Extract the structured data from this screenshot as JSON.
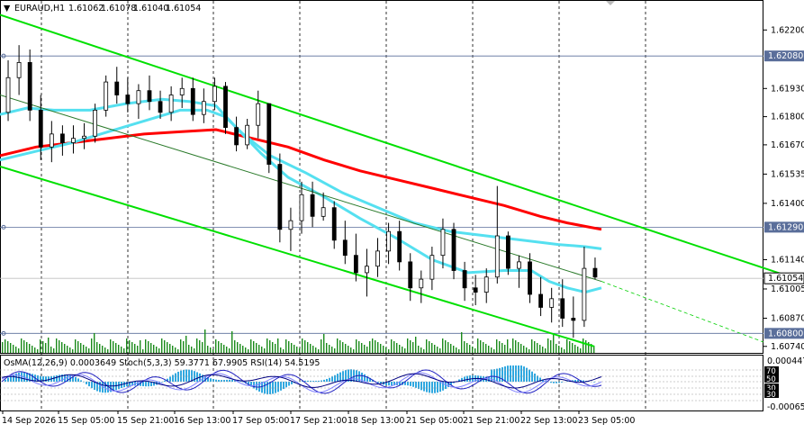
{
  "header": {
    "symbol": "EURAUD,H1",
    "open": "1.61062",
    "high": "1.61078",
    "low": "1.61040",
    "close": "1.61054"
  },
  "price_axis": {
    "labels": [
      {
        "text": "1.62200",
        "value": 1.622
      },
      {
        "text": "1.61930",
        "value": 1.6193
      },
      {
        "text": "1.61800",
        "value": 1.618
      },
      {
        "text": "1.61670",
        "value": 1.6167
      },
      {
        "text": "1.61535",
        "value": 1.61535
      },
      {
        "text": "1.61400",
        "value": 1.614
      },
      {
        "text": "1.61140",
        "value": 1.6114
      },
      {
        "text": "1.61005",
        "value": 1.61005
      },
      {
        "text": "1.60870",
        "value": 1.6087
      },
      {
        "text": "1.60740",
        "value": 1.6074
      }
    ],
    "level_tags": [
      {
        "text": "1.62080",
        "value": 1.6208
      },
      {
        "text": "1.61290",
        "value": 1.6129
      },
      {
        "text": "1.60800",
        "value": 1.608
      }
    ],
    "current_tag": {
      "text": "1.61054",
      "value": 1.61054
    }
  },
  "time_axis": [
    "14 Sep 2026",
    "15 Sep 05:00",
    "15 Sep 21:00",
    "16 Sep 13:00",
    "17 Sep 05:00",
    "17 Sep 21:00",
    "18 Sep 13:00",
    "21 Sep 05:00",
    "21 Sep 21:00",
    "22 Sep 13:00",
    "23 Sep 05:00"
  ],
  "indicator": {
    "title": "OsMA(12,26,9) 0.0003649  Stoch(5,3,3) 59.3771 67.9905  RSI(14) 54.5195",
    "top_label": "0.000447",
    "bottom_label": "-0.000655",
    "levels": [
      "70",
      "50",
      "30"
    ]
  },
  "chart_data": {
    "type": "candlestick",
    "y_range": [
      1.6071,
      1.6233
    ],
    "support_resistance_levels": [
      1.6208,
      1.6129,
      1.608
    ],
    "moving_averages": [
      {
        "color": "#ff0000",
        "points": [
          [
            0,
            1.6162
          ],
          [
            40,
            1.6166
          ],
          [
            80,
            1.6168
          ],
          [
            120,
            1.617
          ],
          [
            160,
            1.6172
          ],
          [
            200,
            1.6173
          ],
          [
            240,
            1.6174
          ],
          [
            280,
            1.617
          ],
          [
            320,
            1.6166
          ],
          [
            360,
            1.616
          ],
          [
            400,
            1.6155
          ],
          [
            440,
            1.6151
          ],
          [
            480,
            1.6147
          ],
          [
            520,
            1.6143
          ],
          [
            560,
            1.6139
          ],
          [
            600,
            1.6134
          ],
          [
            630,
            1.6131
          ],
          [
            655,
            1.6129
          ],
          [
            668,
            1.6128
          ]
        ]
      },
      {
        "color": "#55e0f0",
        "points": [
          [
            0,
            1.616
          ],
          [
            40,
            1.6164
          ],
          [
            80,
            1.6168
          ],
          [
            120,
            1.6173
          ],
          [
            160,
            1.6178
          ],
          [
            200,
            1.6183
          ],
          [
            230,
            1.6183
          ],
          [
            250,
            1.618
          ],
          [
            270,
            1.6172
          ],
          [
            300,
            1.6162
          ],
          [
            340,
            1.6154
          ],
          [
            380,
            1.6145
          ],
          [
            420,
            1.6138
          ],
          [
            460,
            1.6131
          ],
          [
            500,
            1.6127
          ],
          [
            540,
            1.6125
          ],
          [
            580,
            1.6123
          ],
          [
            620,
            1.6121
          ],
          [
            650,
            1.612
          ],
          [
            668,
            1.6119
          ]
        ]
      },
      {
        "color": "#55e0f0",
        "points": [
          [
            0,
            1.6181
          ],
          [
            30,
            1.6184
          ],
          [
            60,
            1.6183
          ],
          [
            100,
            1.6183
          ],
          [
            140,
            1.6186
          ],
          [
            180,
            1.6188
          ],
          [
            210,
            1.6187
          ],
          [
            240,
            1.6185
          ],
          [
            260,
            1.6176
          ],
          [
            290,
            1.6163
          ],
          [
            320,
            1.6152
          ],
          [
            360,
            1.6143
          ],
          [
            400,
            1.6133
          ],
          [
            440,
            1.6124
          ],
          [
            480,
            1.6114
          ],
          [
            520,
            1.6108
          ],
          [
            560,
            1.6109
          ],
          [
            590,
            1.6109
          ],
          [
            610,
            1.6104
          ],
          [
            630,
            1.6101
          ],
          [
            650,
            1.6099
          ],
          [
            668,
            1.6101
          ]
        ]
      }
    ],
    "channel_lines": [
      {
        "color": "#00e000",
        "from": [
          0,
          1.6227
        ],
        "to": [
          893,
          1.6104
        ]
      },
      {
        "color": "#00e000",
        "from": [
          0,
          1.6157
        ],
        "to": [
          660,
          1.6074
        ]
      },
      {
        "color": "#2a7a2a",
        "from": [
          0,
          1.619
        ],
        "to": [
          668,
          1.6104
        ]
      }
    ],
    "candles": [
      [
        1.6182,
        1.6206,
        1.6178,
        1.6198
      ],
      [
        1.6198,
        1.6213,
        1.619,
        1.6205
      ],
      [
        1.6205,
        1.6211,
        1.6178,
        1.6183
      ],
      [
        1.6183,
        1.619,
        1.616,
        1.6166
      ],
      [
        1.6166,
        1.6178,
        1.6159,
        1.6172
      ],
      [
        1.6172,
        1.6176,
        1.6162,
        1.6168
      ],
      [
        1.6168,
        1.6176,
        1.6163,
        1.617
      ],
      [
        1.617,
        1.6177,
        1.6165,
        1.6171
      ],
      [
        1.6171,
        1.6186,
        1.6168,
        1.6183
      ],
      [
        1.6183,
        1.6199,
        1.618,
        1.6196
      ],
      [
        1.6196,
        1.6203,
        1.6186,
        1.619
      ],
      [
        1.619,
        1.6198,
        1.6182,
        1.6186
      ],
      [
        1.6186,
        1.6195,
        1.6179,
        1.6192
      ],
      [
        1.6192,
        1.6199,
        1.6183,
        1.6187
      ],
      [
        1.6187,
        1.6192,
        1.6179,
        1.6182
      ],
      [
        1.6182,
        1.6194,
        1.6178,
        1.619
      ],
      [
        1.619,
        1.6198,
        1.6184,
        1.6193
      ],
      [
        1.6193,
        1.6198,
        1.6178,
        1.6181
      ],
      [
        1.6181,
        1.6193,
        1.6177,
        1.6187
      ],
      [
        1.6187,
        1.6198,
        1.6183,
        1.6194
      ],
      [
        1.6194,
        1.6196,
        1.6172,
        1.6175
      ],
      [
        1.6175,
        1.618,
        1.6164,
        1.6167
      ],
      [
        1.6167,
        1.6179,
        1.6165,
        1.6176
      ],
      [
        1.6176,
        1.6192,
        1.617,
        1.6186
      ],
      [
        1.6186,
        1.6186,
        1.6154,
        1.6158
      ],
      [
        1.6158,
        1.6163,
        1.6122,
        1.6128
      ],
      [
        1.6128,
        1.6138,
        1.6118,
        1.6132
      ],
      [
        1.6132,
        1.615,
        1.6126,
        1.6144
      ],
      [
        1.6144,
        1.615,
        1.6129,
        1.6134
      ],
      [
        1.6134,
        1.6145,
        1.6132,
        1.6138
      ],
      [
        1.6138,
        1.6141,
        1.6119,
        1.6123
      ],
      [
        1.6123,
        1.6132,
        1.6112,
        1.6116
      ],
      [
        1.6116,
        1.6126,
        1.6104,
        1.6108
      ],
      [
        1.6108,
        1.6119,
        1.6097,
        1.6111
      ],
      [
        1.6111,
        1.6124,
        1.6106,
        1.6118
      ],
      [
        1.6118,
        1.6131,
        1.6112,
        1.6127
      ],
      [
        1.6127,
        1.6132,
        1.6109,
        1.6113
      ],
      [
        1.6113,
        1.6117,
        1.6095,
        1.6101
      ],
      [
        1.6101,
        1.6109,
        1.6094,
        1.6105
      ],
      [
        1.6105,
        1.612,
        1.61,
        1.6116
      ],
      [
        1.6116,
        1.6133,
        1.611,
        1.6128
      ],
      [
        1.6128,
        1.6131,
        1.6105,
        1.6109
      ],
      [
        1.6109,
        1.6113,
        1.6095,
        1.6101
      ],
      [
        1.6101,
        1.6107,
        1.6093,
        1.6099
      ],
      [
        1.6099,
        1.611,
        1.6094,
        1.6106
      ],
      [
        1.6106,
        1.6148,
        1.6103,
        1.6125
      ],
      [
        1.6125,
        1.6127,
        1.6107,
        1.611
      ],
      [
        1.611,
        1.6116,
        1.6101,
        1.6113
      ],
      [
        1.6113,
        1.6117,
        1.6094,
        1.6098
      ],
      [
        1.6098,
        1.6106,
        1.6088,
        1.6092
      ],
      [
        1.6092,
        1.6101,
        1.6085,
        1.6096
      ],
      [
        1.6096,
        1.6105,
        1.6083,
        1.6087
      ],
      [
        1.6087,
        1.6097,
        1.6078,
        1.6086
      ],
      [
        1.6086,
        1.612,
        1.6083,
        1.611
      ],
      [
        1.611,
        1.6115,
        1.6105,
        1.6106
      ]
    ]
  }
}
